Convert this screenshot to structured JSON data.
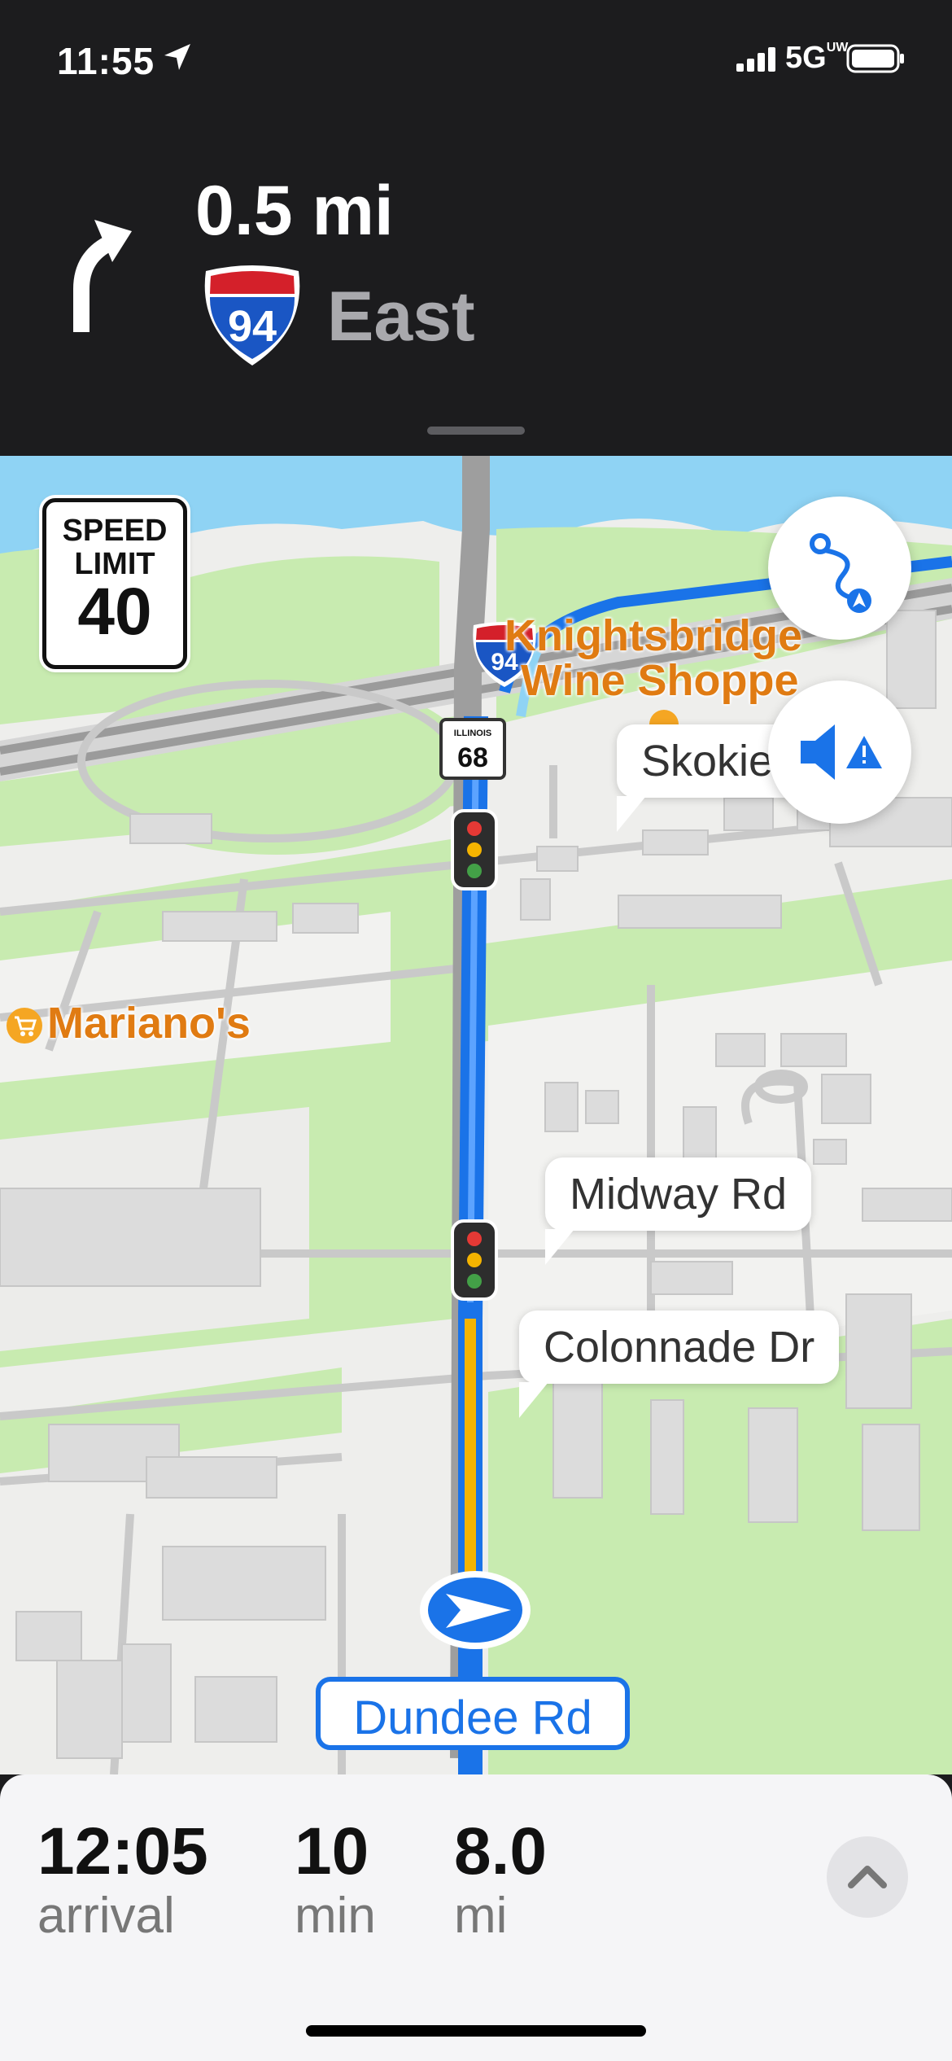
{
  "status_bar": {
    "time": "11:55",
    "network": "5G",
    "network_sub": "UW"
  },
  "nav": {
    "distance": "0.5 mi",
    "route_shield_number": "94",
    "direction": "East",
    "turn_icon": "turn-left-icon"
  },
  "map": {
    "speed_limit": {
      "line1": "SPEED",
      "line2": "LIMIT",
      "value": "40"
    },
    "shield_94": "94",
    "illinois_shield": {
      "state": "ILLINOIS",
      "number": "68"
    },
    "pois": [
      "Knightsbridge",
      "Wine Shoppe",
      "Mariano's"
    ],
    "callouts": [
      "Skokie",
      "Midway Rd",
      "Colonnade Dr"
    ],
    "current_road": "Dundee Rd",
    "buttons": [
      "route-overview-icon",
      "audio-alert-icon"
    ]
  },
  "tray": {
    "arrival": {
      "value": "12:05",
      "label": "arrival"
    },
    "duration": {
      "value": "10",
      "label": "min"
    },
    "distance": {
      "value": "8.0",
      "label": "mi"
    }
  },
  "colors": {
    "route_blue": "#1a73e8",
    "traffic_yellow": "#f5b400",
    "poi_orange": "#e07b12",
    "park_green": "#c8ebb0",
    "water_blue": "#8fd3f4"
  }
}
